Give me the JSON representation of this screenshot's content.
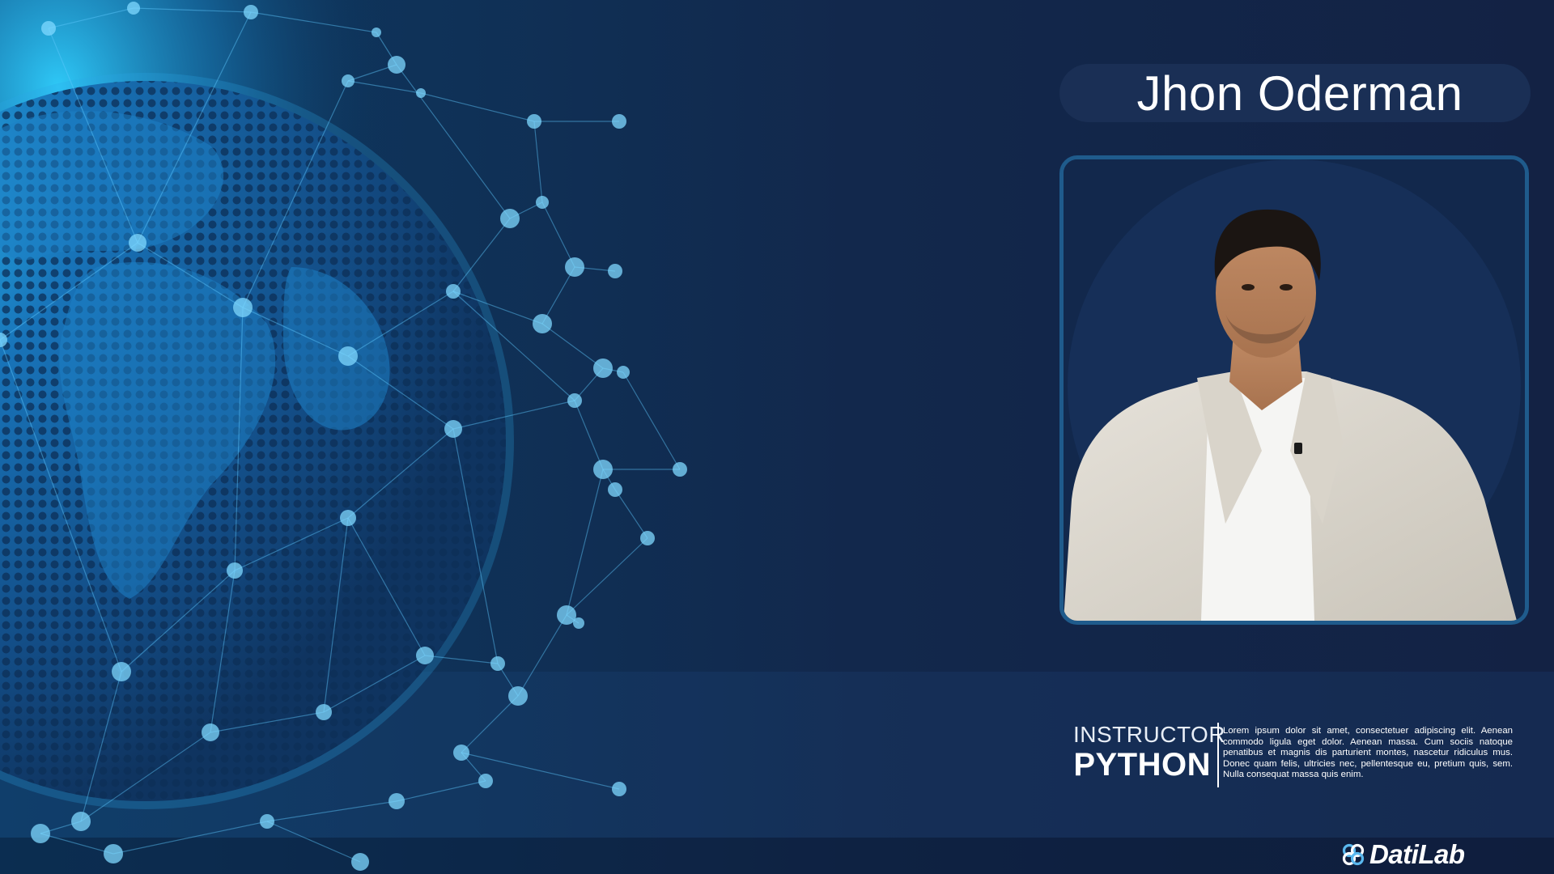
{
  "presenter": {
    "name": "Jhon Oderman"
  },
  "instructor": {
    "label": "INSTRUCTOR",
    "subject": "PYTHON",
    "description": "Lorem ipsum dolor sit amet, consectetuer adipiscing elit. Aenean commodo ligula eget dolor. Aenean massa. Cum sociis natoque penatibus et magnis dis parturient montes, nascetur ridiculus mus. Donec quam felis, ultricies nec, pellentesque eu, pretium quis, sem. Nulla consequat massa quis enim."
  },
  "brand": {
    "name": "DatiLab",
    "icon": "datilab-logo-icon"
  },
  "colors": {
    "background": "#12284c",
    "accent": "#1f5b8c",
    "globe_glow": "#22b8f0"
  },
  "images": {
    "background_graphic": "network-globe",
    "portrait": "instructor-portrait"
  }
}
